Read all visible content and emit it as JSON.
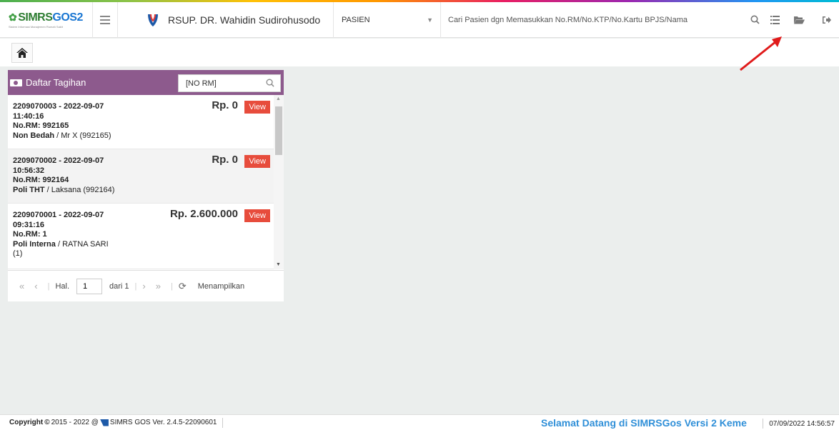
{
  "header": {
    "logo_text_main": "SIMRS",
    "logo_text_g": "GOS2",
    "logo_tagline": "Sistem Informasi Manajemen Rumah Sakit",
    "hospital_name": "RSUP. DR. Wahidin Sudirohusodo",
    "search_type": "PASIEN",
    "search_placeholder": "Cari Pasien dgn Memasukkan No.RM/No.KTP/No.Kartu BPJS/Nama",
    "icons": [
      "menu-icon",
      "search-icon",
      "list-icon",
      "folder-open-icon",
      "logout-icon"
    ]
  },
  "panel": {
    "title": "Daftar Tagihan",
    "search_placeholder": "[NO RM]",
    "view_label": "View",
    "bills": [
      {
        "id_date": "2209070003 - 2022-09-07",
        "time": "11:40:16",
        "rm": "No.RM: 992165",
        "unit": "Non Bedah",
        "patient": " / Mr X (992165)",
        "amount": "Rp. 0"
      },
      {
        "id_date": "2209070002 - 2022-09-07",
        "time": "10:56:32",
        "rm": "No.RM: 992164",
        "unit": "Poli THT",
        "patient": " / Laksana (992164)",
        "amount": "Rp. 0"
      },
      {
        "id_date": "2209070001 - 2022-09-07",
        "time": "09:31:16",
        "rm": "No.RM: 1",
        "unit": "Poli Interna",
        "patient": " / RATNA SARI",
        "patient2": "(1)",
        "amount": "Rp. 2.600.000"
      }
    ],
    "pager": {
      "page_label": "Hal.",
      "page_value": "1",
      "total_label": "dari 1",
      "display_text": "Menampilkan"
    }
  },
  "footer": {
    "copyright_word": "Copyright",
    "years": "2015 - 2022 @",
    "version": "SIMRS GOS Ver. 2.4.5-22090601",
    "marquee": "Selamat Datang di SIMRSGos Versi 2 Keme",
    "datetime": "07/09/2022 14:56:57"
  },
  "colors": {
    "panel_header": "#8d5a8d",
    "view_button": "#e74c3c",
    "marquee": "#2f8fd8",
    "annotation_arrow": "#e01b1b"
  }
}
